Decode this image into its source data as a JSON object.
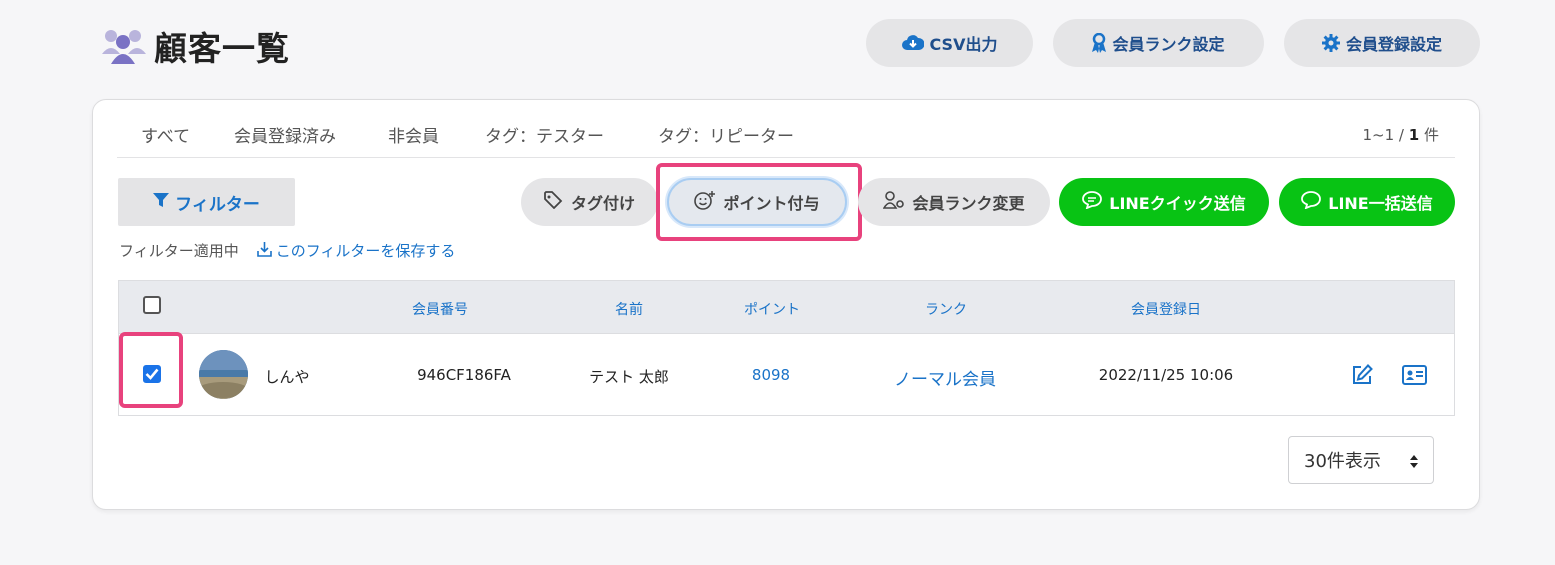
{
  "header": {
    "title": "顧客一覧",
    "csv_label": "CSV出力",
    "rank_settings_label": "会員ランク設定",
    "registration_settings_label": "会員登録設定"
  },
  "tabs": [
    {
      "label": "すべて"
    },
    {
      "label": "会員登録済み"
    },
    {
      "label": "非会員"
    },
    {
      "label": "タグ：テスター"
    },
    {
      "label": "タグ：リピーター"
    }
  ],
  "pagination": {
    "range": "1~1 /",
    "total": "1",
    "unit": "件"
  },
  "toolbar": {
    "filter_label": "フィルター",
    "tag_label": "タグ付け",
    "point_label": "ポイント付与",
    "rank_change_label": "会員ランク変更",
    "line_quick_label": "LINEクイック送信",
    "line_bulk_label": "LINE一括送信"
  },
  "filter_status": {
    "applied": "フィルター適用中",
    "save_link": "このフィルターを保存する"
  },
  "table": {
    "headers": {
      "member_no": "会員番号",
      "name": "名前",
      "points": "ポイント",
      "rank": "ランク",
      "registered": "会員登録日"
    },
    "rows": [
      {
        "checked": true,
        "nickname": "しんや",
        "member_no": "946CF186FA",
        "name": "テスト 太郎",
        "points": "8098",
        "rank": "ノーマル会員",
        "registered": "2022/11/25 10:06"
      }
    ]
  },
  "page_size": {
    "selected": "30件表示"
  },
  "colors": {
    "accent_blue": "#1a73c8",
    "line_green": "#08c314",
    "highlight_pink": "#e8427d"
  }
}
